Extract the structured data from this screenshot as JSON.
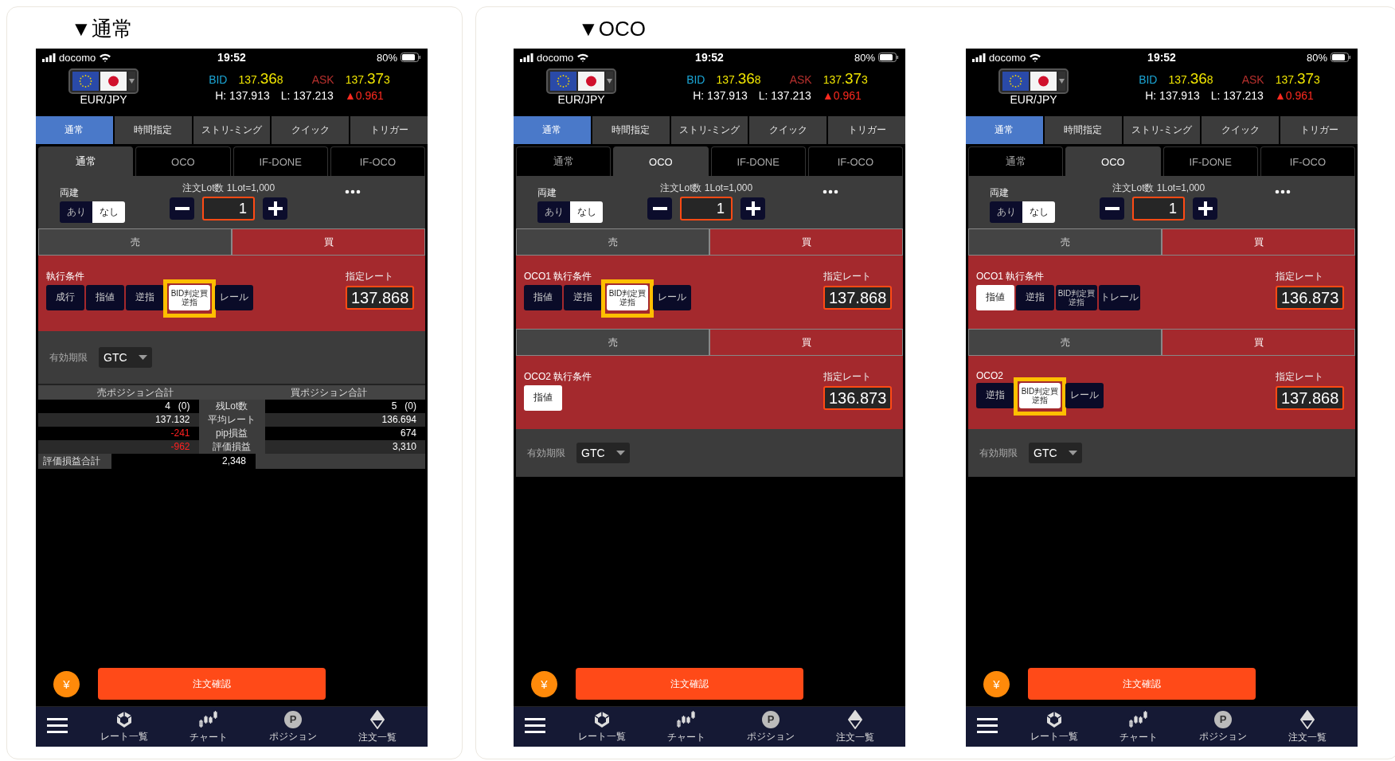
{
  "panels": [
    {
      "heading": "▼通常",
      "phones": [
        {
          "status": {
            "carrier": "docomo",
            "time": "19:52",
            "battery": "80%"
          },
          "quote": {
            "pair": "EUR/JPY",
            "bid": {
              "label": "BID",
              "head": "137.",
              "big": "36",
              "tail": "8"
            },
            "ask": {
              "label": "ASK",
              "head": "137.",
              "big": "37",
              "tail": "3"
            },
            "high": "H: 137.913",
            "low": "L: 137.213",
            "change": "▲0.961"
          },
          "top_tabs": [
            {
              "label": "通常",
              "selected": true
            },
            {
              "label": "時間指定",
              "selected": false
            },
            {
              "label": "ストリ-ミング",
              "selected": false
            },
            {
              "label": "クイック",
              "selected": false
            },
            {
              "label": "トリガー",
              "selected": false
            }
          ],
          "order_tabs": [
            {
              "label": "通常",
              "selected": true
            },
            {
              "label": "OCO",
              "selected": false
            },
            {
              "label": "IF-DONE",
              "selected": false
            },
            {
              "label": "IF-OCO",
              "selected": false
            }
          ],
          "hedge": {
            "label": "両建",
            "options": [
              {
                "label": "あり",
                "selected": false
              },
              {
                "label": "なし",
                "selected": true
              }
            ]
          },
          "lot": {
            "label": "注文Lot数",
            "unit": "1Lot=1,000",
            "value": "1"
          },
          "orders": [
            {
              "sides": [
                {
                  "label": "売",
                  "selected": false
                },
                {
                  "label": "買",
                  "selected": true
                }
              ],
              "title": "執行条件",
              "types": [
                {
                  "label": "成行",
                  "selected": false,
                  "highlighted": false
                },
                {
                  "label": "指値",
                  "selected": false,
                  "highlighted": false
                },
                {
                  "label": "逆指",
                  "selected": false,
                  "highlighted": false
                },
                {
                  "label": "BID判定買逆指",
                  "selected": true,
                  "highlighted": true
                },
                {
                  "label": "レール",
                  "selected": false,
                  "highlighted": false
                }
              ],
              "rate_label": "指定レート",
              "rate": "137.868"
            }
          ],
          "expiry": {
            "label": "有効期限",
            "value": "GTC"
          },
          "positions": {
            "sell_header": "売ポジション合計",
            "buy_header": "買ポジション合計",
            "rows": [
              {
                "sell": "4   (0)",
                "label": "残Lot数",
                "buy": "5   (0)",
                "sell_loss": false
              },
              {
                "sell": "137.132",
                "label": "平均レート",
                "buy": "136.694",
                "sell_loss": false
              },
              {
                "sell": "-241",
                "label": "pip損益",
                "buy": "674",
                "sell_loss": true
              },
              {
                "sell": "-962",
                "label": "評価損益",
                "buy": "3,310",
                "sell_loss": true
              }
            ],
            "total_label": "評価損益合計",
            "total": "2,348"
          },
          "yen": "¥",
          "confirm": "注文確認",
          "nav": [
            {
              "kind": "menu"
            },
            {
              "kind": "rates",
              "label": "レート一覧"
            },
            {
              "kind": "chart",
              "label": "チャート"
            },
            {
              "kind": "position",
              "label": "ポジション",
              "badge": "P"
            },
            {
              "kind": "orders",
              "label": "注文一覧"
            }
          ]
        }
      ]
    },
    {
      "heading": "▼OCO",
      "phones": [
        {
          "status": {
            "carrier": "docomo",
            "time": "19:52",
            "battery": "80%"
          },
          "quote": {
            "pair": "EUR/JPY",
            "bid": {
              "label": "BID",
              "head": "137.",
              "big": "36",
              "tail": "8"
            },
            "ask": {
              "label": "ASK",
              "head": "137.",
              "big": "37",
              "tail": "3"
            },
            "high": "H: 137.913",
            "low": "L: 137.213",
            "change": "▲0.961"
          },
          "top_tabs": [
            {
              "label": "通常",
              "selected": true
            },
            {
              "label": "時間指定",
              "selected": false
            },
            {
              "label": "ストリ-ミング",
              "selected": false
            },
            {
              "label": "クイック",
              "selected": false
            },
            {
              "label": "トリガー",
              "selected": false
            }
          ],
          "order_tabs": [
            {
              "label": "通常",
              "selected": false
            },
            {
              "label": "OCO",
              "selected": true
            },
            {
              "label": "IF-DONE",
              "selected": false
            },
            {
              "label": "IF-OCO",
              "selected": false
            }
          ],
          "hedge": {
            "label": "両建",
            "options": [
              {
                "label": "あり",
                "selected": false
              },
              {
                "label": "なし",
                "selected": true
              }
            ]
          },
          "lot": {
            "label": "注文Lot数",
            "unit": "1Lot=1,000",
            "value": "1"
          },
          "orders": [
            {
              "sides": [
                {
                  "label": "売",
                  "selected": false
                },
                {
                  "label": "買",
                  "selected": true
                }
              ],
              "title": "OCO1 執行条件",
              "types": [
                {
                  "label": "指値",
                  "selected": false,
                  "highlighted": false
                },
                {
                  "label": "逆指",
                  "selected": false,
                  "highlighted": false
                },
                {
                  "label": "BID判定買逆指",
                  "selected": true,
                  "highlighted": true
                },
                {
                  "label": "レール",
                  "selected": false,
                  "highlighted": false
                }
              ],
              "rate_label": "指定レート",
              "rate": "137.868"
            },
            {
              "sides": [
                {
                  "label": "売",
                  "selected": false
                },
                {
                  "label": "買",
                  "selected": true
                }
              ],
              "title": "OCO2 執行条件",
              "types": [
                {
                  "label": "指値",
                  "selected": true,
                  "highlighted": false
                }
              ],
              "rate_label": "指定レート",
              "rate": "136.873"
            }
          ],
          "expiry": {
            "label": "有効期限",
            "value": "GTC"
          },
          "yen": "¥",
          "confirm": "注文確認",
          "nav": [
            {
              "kind": "menu"
            },
            {
              "kind": "rates",
              "label": "レート一覧"
            },
            {
              "kind": "chart",
              "label": "チャート"
            },
            {
              "kind": "position",
              "label": "ポジション",
              "badge": "P"
            },
            {
              "kind": "orders",
              "label": "注文一覧"
            }
          ]
        },
        {
          "status": {
            "carrier": "docomo",
            "time": "19:52",
            "battery": "80%"
          },
          "quote": {
            "pair": "EUR/JPY",
            "bid": {
              "label": "BID",
              "head": "137.",
              "big": "36",
              "tail": "8"
            },
            "ask": {
              "label": "ASK",
              "head": "137.",
              "big": "37",
              "tail": "3"
            },
            "high": "H: 137.913",
            "low": "L: 137.213",
            "change": "▲0.961"
          },
          "top_tabs": [
            {
              "label": "通常",
              "selected": true
            },
            {
              "label": "時間指定",
              "selected": false
            },
            {
              "label": "ストリ-ミング",
              "selected": false
            },
            {
              "label": "クイック",
              "selected": false
            },
            {
              "label": "トリガー",
              "selected": false
            }
          ],
          "order_tabs": [
            {
              "label": "通常",
              "selected": false
            },
            {
              "label": "OCO",
              "selected": true
            },
            {
              "label": "IF-DONE",
              "selected": false
            },
            {
              "label": "IF-OCO",
              "selected": false
            }
          ],
          "hedge": {
            "label": "両建",
            "options": [
              {
                "label": "あり",
                "selected": false
              },
              {
                "label": "なし",
                "selected": true
              }
            ]
          },
          "lot": {
            "label": "注文Lot数",
            "unit": "1Lot=1,000",
            "value": "1"
          },
          "orders": [
            {
              "sides": [
                {
                  "label": "売",
                  "selected": false
                },
                {
                  "label": "買",
                  "selected": true
                }
              ],
              "title": "OCO1 執行条件",
              "types": [
                {
                  "label": "指値",
                  "selected": true,
                  "highlighted": false
                },
                {
                  "label": "逆指",
                  "selected": false,
                  "highlighted": false
                },
                {
                  "label": "BID判定買逆指",
                  "selected": false,
                  "highlighted": false
                },
                {
                  "label": "トレール",
                  "selected": false,
                  "highlighted": false
                }
              ],
              "rate_label": "指定レート",
              "rate": "136.873"
            },
            {
              "sides": [
                {
                  "label": "売",
                  "selected": false
                },
                {
                  "label": "買",
                  "selected": true
                }
              ],
              "title": "OCO2",
              "types": [
                {
                  "label": "逆指",
                  "selected": false,
                  "highlighted": false
                },
                {
                  "label": "BID判定買逆指",
                  "selected": true,
                  "highlighted": true
                },
                {
                  "label": "レール",
                  "selected": false,
                  "highlighted": false
                }
              ],
              "rate_label": "指定レート",
              "rate": "137.868"
            }
          ],
          "expiry": {
            "label": "有効期限",
            "value": "GTC"
          },
          "yen": "¥",
          "confirm": "注文確認",
          "nav": [
            {
              "kind": "menu"
            },
            {
              "kind": "rates",
              "label": "レート一覧"
            },
            {
              "kind": "chart",
              "label": "チャート"
            },
            {
              "kind": "position",
              "label": "ポジション",
              "badge": "P"
            },
            {
              "kind": "orders",
              "label": "注文一覧"
            }
          ]
        }
      ]
    }
  ]
}
